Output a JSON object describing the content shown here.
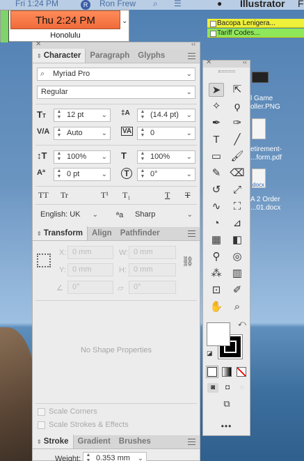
{
  "menubar": {
    "time": "Fri 1:24 PM",
    "user": "Ron Frew",
    "app": "Illustrator",
    "extra": "F"
  },
  "clock": {
    "time": "Thu 2:24 PM",
    "city": "Honolulu"
  },
  "stickies": [
    "Bacopa Lenigera...",
    "Tariff Codes..."
  ],
  "desktop": {
    "items": [
      {
        "line1": "l Game",
        "line2": "oller.PNG"
      },
      {
        "line1": "etirement-",
        "line2": "...form.pdf"
      },
      {
        "line1": "A 2 Order",
        "line2": "...01.docx"
      }
    ],
    "docx_badge": "docx"
  },
  "character_panel": {
    "tabs": [
      "Character",
      "Paragraph",
      "Glyphs"
    ],
    "font_family": "Myriad Pro",
    "font_style": "Regular",
    "font_size": "12 pt",
    "leading": "(14.4 pt)",
    "kerning": "Auto",
    "tracking": "0",
    "vertical_scale": "100%",
    "horizontal_scale": "100%",
    "baseline_shift": "0 pt",
    "rotation": "0°",
    "style_buttons": [
      "TT",
      "Tr",
      "T¹",
      "T₁",
      "T",
      "T"
    ],
    "language": "English: UK",
    "antialias_icon": "ªa",
    "antialias": "Sharp"
  },
  "transform_panel": {
    "tabs": [
      "Transform",
      "Align",
      "Pathfinder"
    ],
    "x_label": "X:",
    "x_value": "0 mm",
    "w_label": "W:",
    "w_value": "0 mm",
    "y_label": "Y:",
    "y_value": "0 mm",
    "h_label": "H:",
    "h_value": "0 mm",
    "angle_value": "0°",
    "shear_value": "0°",
    "empty_message": "No Shape Properties",
    "scale_corners": "Scale Corners",
    "scale_strokes": "Scale Strokes & Effects"
  },
  "stroke_panel": {
    "tabs": [
      "Stroke",
      "Gradient",
      "Brushes"
    ],
    "weight_label": "Weight:",
    "weight_value": "0.353 mm"
  },
  "toolbox": {
    "more": "•••"
  }
}
